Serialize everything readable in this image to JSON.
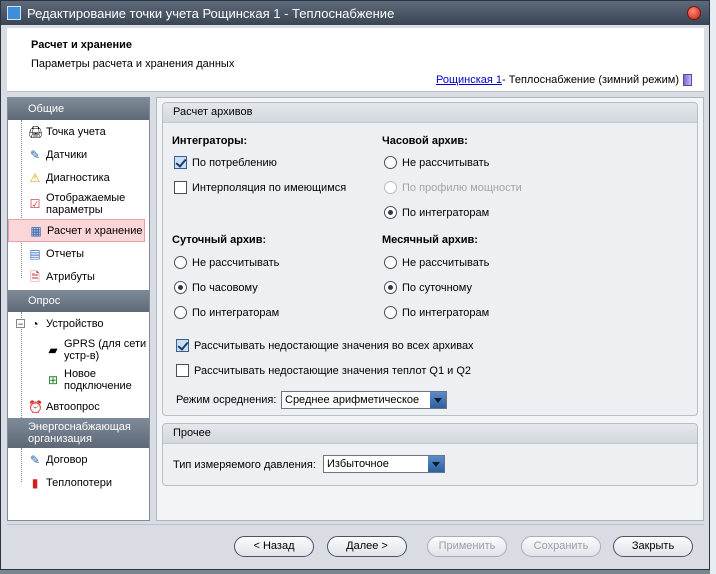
{
  "window": {
    "title": "Редактирование точки учета Рощинская 1 - Теплоснабжение"
  },
  "header": {
    "title": "Расчет и хранение",
    "subtitle": "Параметры расчета и хранения данных",
    "breadcrumb_link": "Рощинская 1",
    "breadcrumb_rest": " - Теплоснабжение (зимний режим)"
  },
  "sidebar": {
    "groups": [
      {
        "label": "Общие",
        "items": [
          {
            "label": "Точка учета",
            "icon": "meter-point-icon"
          },
          {
            "label": "Датчики",
            "icon": "pencil-sensor-icon"
          },
          {
            "label": "Диагностика",
            "icon": "warning-icon"
          },
          {
            "label": "Отображаемые параметры",
            "icon": "checklist-icon"
          },
          {
            "label": "Расчет и хранение",
            "icon": "calculator-icon",
            "selected": true
          },
          {
            "label": "Отчеты",
            "icon": "report-icon"
          },
          {
            "label": "Атрибуты",
            "icon": "attributes-icon"
          }
        ]
      },
      {
        "label": "Опрос",
        "items": [
          {
            "label": "Устройство",
            "icon": "device-gauge-icon"
          },
          {
            "label": "GPRS (для сети устр-в)",
            "icon": "gprs-modem-icon"
          },
          {
            "label": "Новое подключение",
            "icon": "new-connection-icon"
          },
          {
            "label": "Автоопрос",
            "icon": "alarm-clock-icon"
          }
        ]
      },
      {
        "label": "Энергоснабжающая организация",
        "items": [
          {
            "label": "Договор",
            "icon": "contract-pen-icon"
          },
          {
            "label": "Теплопотери",
            "icon": "fire-extinguisher-icon"
          }
        ]
      }
    ]
  },
  "archive": {
    "group_title": "Расчет архивов",
    "integrators": {
      "label": "Интеграторы:",
      "by_consumption": "По потреблению",
      "interpolation": "Интерполяция по имеющимся"
    },
    "hourly": {
      "label": "Часовой архив:",
      "opt1": "Не рассчитывать",
      "opt2": "По профилю мощности",
      "opt3": "По интеграторам"
    },
    "daily": {
      "label": "Суточный архив:",
      "opt1": "Не рассчитывать",
      "opt2": "По часовому",
      "opt3": "По интеграторам"
    },
    "monthly": {
      "label": "Месячный архив:",
      "opt1": "Не рассчитывать",
      "opt2": "По суточному",
      "opt3": "По интеграторам"
    },
    "calc_missing_all": "Рассчитывать недостающие значения во всех архивах",
    "calc_missing_q": "Рассчитывать недостающие значения теплот Q1 и Q2",
    "averaging_label": "Режим осреднения:",
    "averaging_value": "Среднее арифметическое"
  },
  "other": {
    "group_title": "Прочее",
    "pressure_label": "Тип измеряемого давления:",
    "pressure_value": "Избыточное"
  },
  "buttons": {
    "back": "< Назад",
    "next": "Далее >",
    "apply": "Применить",
    "save": "Сохранить",
    "close": "Закрыть"
  }
}
